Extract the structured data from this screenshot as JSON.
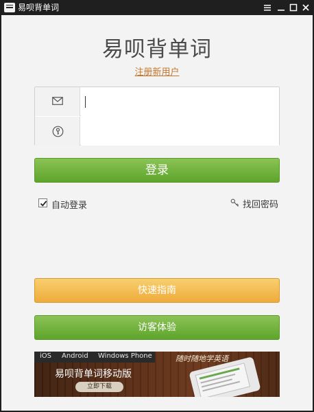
{
  "window": {
    "title": "易呗背单词"
  },
  "header": {
    "app_title": "易呗背单词",
    "register_link": "注册新用户"
  },
  "login_form": {
    "email_value": "",
    "password_value": ""
  },
  "buttons": {
    "login": "登录",
    "quick_guide": "快速指南",
    "guest": "访客体验"
  },
  "options": {
    "auto_login_label": "自动登录",
    "auto_login_checked": true,
    "forgot_password": "找回密码"
  },
  "banner": {
    "platforms": [
      "iOS",
      "Android",
      "Windows Phone"
    ],
    "slogan": "随时随地学英语",
    "title": "易呗背单词移动版",
    "download_label": "立即下载"
  },
  "colors": {
    "green_button": "#6cb23a",
    "orange_button": "#f3bc52",
    "link": "#c4762a",
    "titlebar": "#1f1f1f"
  },
  "icons": {
    "email": "envelope-icon",
    "password": "key-circle-icon",
    "forgot": "key-icon"
  }
}
